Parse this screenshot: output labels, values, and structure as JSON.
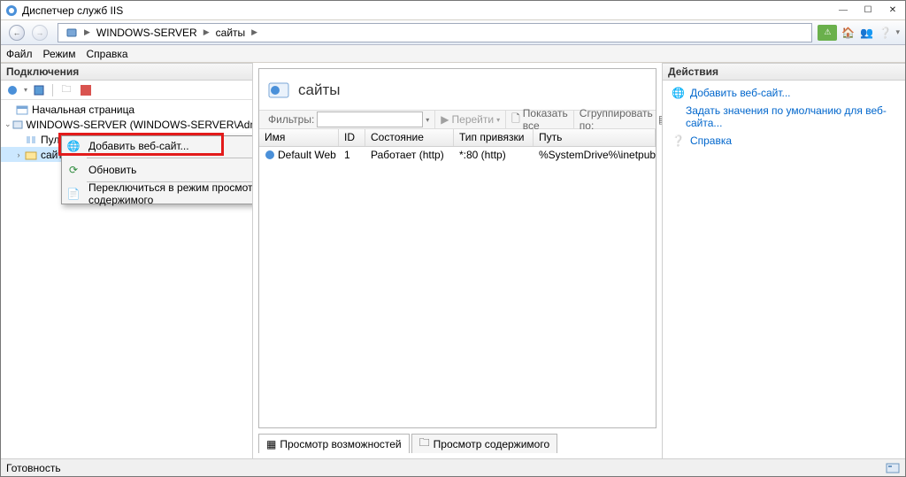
{
  "window": {
    "title": "Диспетчер служб IIS"
  },
  "titlebar_buttons": {
    "min": "—",
    "max": "☐",
    "close": "✕"
  },
  "breadcrumb": {
    "seg1": "WINDOWS-SERVER",
    "seg2": "сайты"
  },
  "menu": {
    "file": "Файл",
    "mode": "Режим",
    "help": "Справка"
  },
  "left": {
    "header": "Подключения",
    "tree": {
      "root": "Начальная страница",
      "server": "WINDOWS-SERVER (WINDOWS-SERVER\\Administrator)",
      "app_pools": "Пулы приложений",
      "sites": "сайты"
    }
  },
  "context_menu": {
    "add_site": "Добавить веб-сайт...",
    "refresh": "Обновить",
    "switch_view": "Переключиться в режим просмотра содержимого"
  },
  "center": {
    "title": "сайты",
    "filter_label": "Фильтры:",
    "go": "Перейти",
    "show_all": "Показать все",
    "group_by": "Сгруппировать по:",
    "columns": {
      "name": "Имя",
      "id": "ID",
      "state": "Состояние",
      "binding": "Тип привязки",
      "path": "Путь"
    },
    "row": {
      "name": "Default Web Site",
      "id": "1",
      "state": "Работает (http)",
      "binding": "*:80 (http)",
      "path": "%SystemDrive%\\inetpub\\wwwroot"
    },
    "tabs": {
      "features": "Просмотр возможностей",
      "content": "Просмотр содержимого"
    }
  },
  "right": {
    "header": "Действия",
    "add_site": "Добавить веб-сайт...",
    "set_defaults": "Задать значения по умолчанию для веб-сайта...",
    "help": "Справка"
  },
  "status": {
    "ready": "Готовность"
  }
}
